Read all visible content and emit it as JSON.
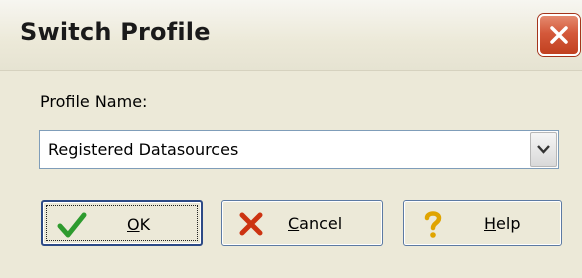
{
  "window": {
    "title": "Switch Profile"
  },
  "form": {
    "label": "Profile Name:",
    "selected_value": "Registered Datasources"
  },
  "buttons": {
    "ok": {
      "mnemonic": "O",
      "rest": "K",
      "icon": "checkmark-icon"
    },
    "cancel": {
      "mnemonic": "C",
      "rest": "ancel",
      "icon": "x-icon"
    },
    "help": {
      "mnemonic": "H",
      "rest": "elp",
      "icon": "question-icon"
    }
  },
  "colors": {
    "close_button": "#d4593b",
    "check": "#2e9b2e",
    "cancel_x": "#cc3311",
    "help_q": "#e0a400"
  }
}
